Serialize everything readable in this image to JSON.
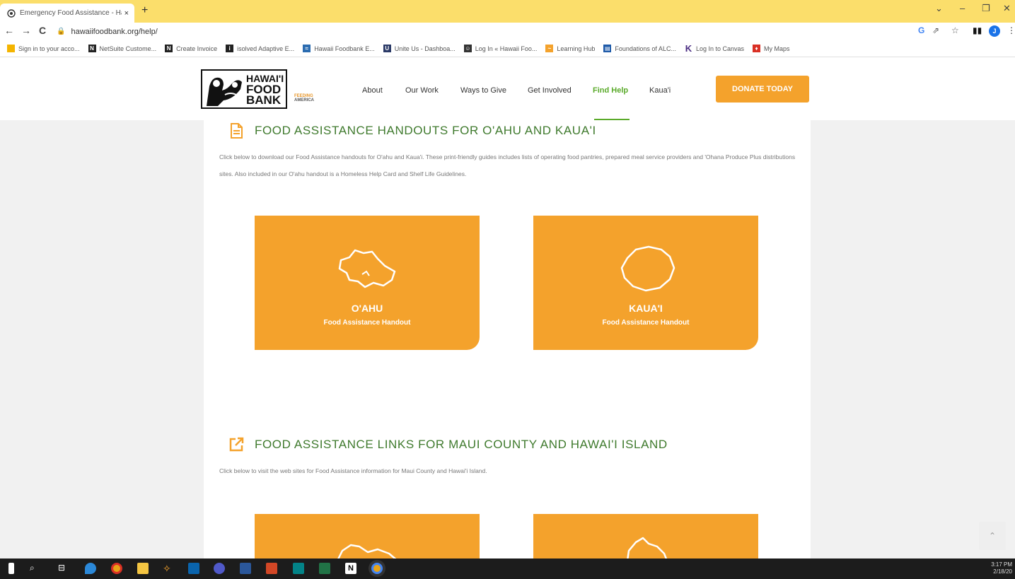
{
  "browser": {
    "tab_title": "Emergency Food Assistance - Ha",
    "tab_close": "×",
    "new_tab": "+",
    "url": "hawaiifoodbank.org/help/",
    "window_controls": [
      "⌄",
      "–",
      "❐",
      "✕"
    ],
    "profile_initial": "J"
  },
  "bookmarks": [
    {
      "label": "Sign in to your acco...",
      "icon": "bookmark-icon",
      "color": "#f4b400"
    },
    {
      "label": "NetSuite  Custome...",
      "icon": "netsuite-icon",
      "color": "#222"
    },
    {
      "label": "Create Invoice",
      "icon": "netsuite-icon",
      "color": "#222"
    },
    {
      "label": "isolved Adaptive E...",
      "icon": "isolved-icon",
      "color": "#222"
    },
    {
      "label": "Hawaii Foodbank E...",
      "icon": "foodbank-icon",
      "color": "#2b6cb0"
    },
    {
      "label": "Unite Us - Dashboa...",
      "icon": "uniteus-icon",
      "color": "#2b3a67"
    },
    {
      "label": "Log In « Hawaii Foo...",
      "icon": "foodbank-icon",
      "color": "#333"
    },
    {
      "label": "Learning Hub",
      "icon": "learning-icon",
      "color": "#f4a22c"
    },
    {
      "label": "Foundations of ALC...",
      "icon": "course-icon",
      "color": "#1e5aa8"
    },
    {
      "label": "Log In to Canvas",
      "icon": "canvas-icon",
      "color": "#4b2e83"
    },
    {
      "label": "My Maps",
      "icon": "maps-icon",
      "color": "#d93025"
    }
  ],
  "site": {
    "logo_words": [
      "HAWAI'I",
      "FOOD",
      "BANK"
    ],
    "partner": {
      "top": "FEEDING",
      "bottom": "AMERICA"
    },
    "menu": [
      "About",
      "Our Work",
      "Ways to Give",
      "Get Involved",
      "Find Help",
      "Kaua'i"
    ],
    "active_menu": "Find Help",
    "donate": "DONATE TODAY",
    "accent_color": "#f4a22c",
    "heading_color": "#3f7a2d"
  },
  "sections": [
    {
      "heading": "FOOD ASSISTANCE HANDOUTS FOR O'AHU AND KAUA'I",
      "icon": "document-icon",
      "text": "Click below to download our Food Assistance handouts for O'ahu and Kaua'i. These print-friendly guides includes lists of operating food pantries, prepared meal service providers and 'Ohana Produce Plus distributions sites. Also included in our O'ahu handout is a Homeless Help Card and Shelf Life Guidelines.",
      "cards": [
        {
          "name": "O'AHU",
          "sub": "Food Assistance Handout",
          "icon": "oahu-island-icon"
        },
        {
          "name": "KAUA'I",
          "sub": "Food Assistance Handout",
          "icon": "kauai-island-icon"
        }
      ]
    },
    {
      "heading": "FOOD ASSISTANCE LINKS FOR MAUI COUNTY AND HAWAI'I ISLAND",
      "icon": "external-link-icon",
      "text": "Click below to visit the web sites for Food Assistance information for Maui County and Hawai'i Island.",
      "cards": [
        {
          "icon": "maui-island-icon"
        },
        {
          "icon": "hawaii-island-icon"
        }
      ]
    }
  ],
  "taskbar": {
    "time": "3:17 PM",
    "date": "2/18/20"
  }
}
